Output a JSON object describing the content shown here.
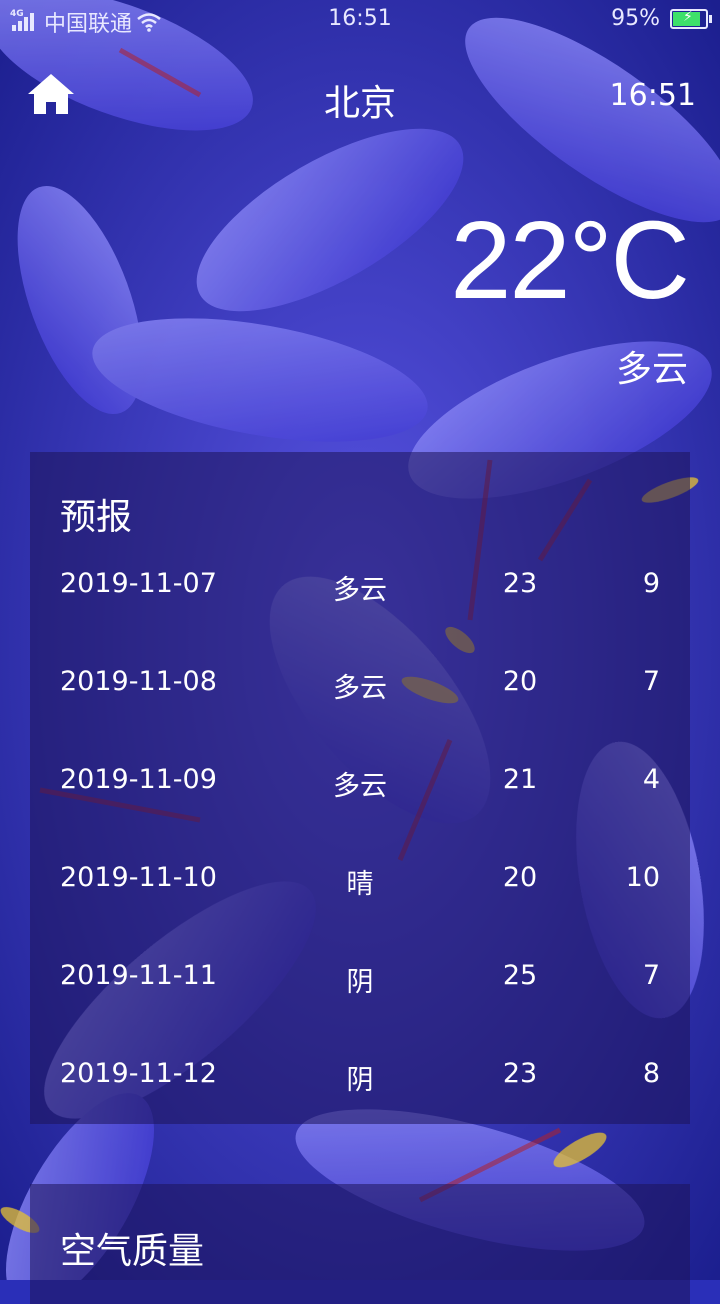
{
  "status_bar": {
    "network_type": "4G",
    "carrier": "中国联通",
    "time": "16:51",
    "battery": "95%",
    "battery_level": 0.95,
    "icons": [
      "signal-icon",
      "wifi-icon",
      "battery-icon"
    ]
  },
  "header": {
    "home_icon": "home-icon",
    "city": "北京",
    "update_time": "16:51"
  },
  "now": {
    "temperature": "22°C",
    "condition": "多云"
  },
  "forecast": {
    "title": "预报",
    "days": [
      {
        "date": "2019-11-07",
        "condition": "多云",
        "max": "23",
        "min": "9"
      },
      {
        "date": "2019-11-08",
        "condition": "多云",
        "max": "20",
        "min": "7"
      },
      {
        "date": "2019-11-09",
        "condition": "多云",
        "max": "21",
        "min": "4"
      },
      {
        "date": "2019-11-10",
        "condition": "晴",
        "max": "20",
        "min": "10"
      },
      {
        "date": "2019-11-11",
        "condition": "阴",
        "max": "25",
        "min": "7"
      },
      {
        "date": "2019-11-12",
        "condition": "阴",
        "max": "23",
        "min": "8"
      }
    ]
  },
  "aqi": {
    "title": "空气质量"
  },
  "colors": {
    "panel": "#1e145a",
    "background": "#2a2fb8",
    "battery_fill": "#3ee06a",
    "text": "#ffffff"
  }
}
